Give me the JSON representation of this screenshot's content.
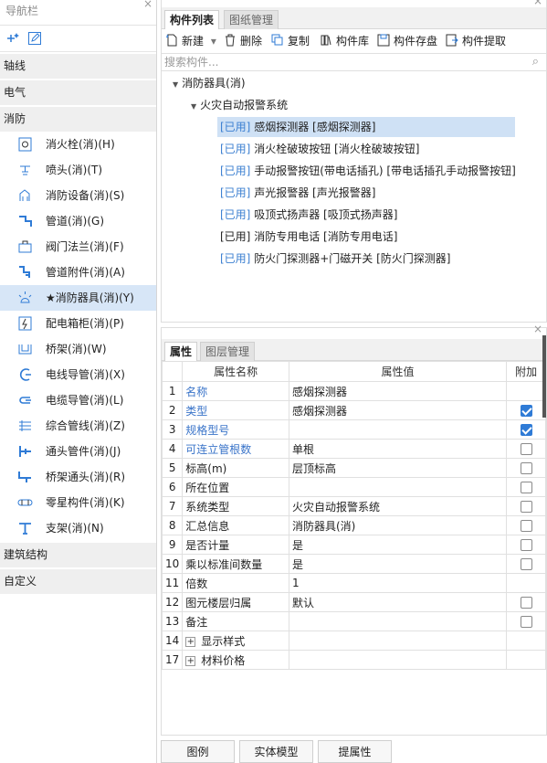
{
  "nav": {
    "title": "导航栏",
    "close": "×",
    "categories": {
      "axis": "轴线",
      "electric": "电气",
      "fire": "消防",
      "building": "建筑结构",
      "custom": "自定义"
    },
    "items": [
      {
        "label": "消火栓(消)(H)"
      },
      {
        "label": "喷头(消)(T)"
      },
      {
        "label": "消防设备(消)(S)"
      },
      {
        "label": "管道(消)(G)"
      },
      {
        "label": "阀门法兰(消)(F)"
      },
      {
        "label": "管道附件(消)(A)"
      },
      {
        "label": "★消防器具(消)(Y)"
      },
      {
        "label": "配电箱柜(消)(P)"
      },
      {
        "label": "桥架(消)(W)"
      },
      {
        "label": "电线导管(消)(X)"
      },
      {
        "label": "电缆导管(消)(L)"
      },
      {
        "label": "综合管线(消)(Z)"
      },
      {
        "label": "通头管件(消)(J)"
      },
      {
        "label": "桥架通头(消)(R)"
      },
      {
        "label": "零星构件(消)(K)"
      },
      {
        "label": "支架(消)(N)"
      }
    ],
    "selected_index": 6
  },
  "top": {
    "close": "×",
    "tabs": [
      "构件列表",
      "图纸管理"
    ],
    "toolbar": {
      "new": "新建",
      "new_dropdown": "▾",
      "delete": "删除",
      "copy": "复制",
      "library": "构件库",
      "save": "构件存盘",
      "extract": "构件提取"
    },
    "search_placeholder": "搜索构件...",
    "search_icon": "⌕",
    "tree_root": "消防器具(消)",
    "tree_group": "火灾自动报警系统",
    "components": [
      {
        "tag": "[已用]",
        "name": "感烟探测器 [感烟探测器]"
      },
      {
        "tag": "[已用]",
        "name": "消火栓破玻按钮 [消火栓破玻按钮]"
      },
      {
        "tag": "[已用]",
        "name": "手动报警按钮(带电话插孔) [带电话插孔手动报警按钮]"
      },
      {
        "tag": "[已用]",
        "name": "声光报警器 [声光报警器]"
      },
      {
        "tag": "[已用]",
        "name": "吸顶式扬声器 [吸顶式扬声器]"
      },
      {
        "tag": "[已用]",
        "name": "消防专用电话 [消防专用电话]"
      },
      {
        "tag": "[已用]",
        "name": "防火门探测器+门磁开关 [防火门探测器]"
      }
    ]
  },
  "props": {
    "close": "×",
    "tabs": [
      "属性",
      "图层管理"
    ],
    "headers": {
      "name": "属性名称",
      "value": "属性值",
      "extra": "附加"
    },
    "rows": [
      {
        "num": "1",
        "name": "名称",
        "value": "感烟探测器",
        "blue": true,
        "cb": "none"
      },
      {
        "num": "2",
        "name": "类型",
        "value": "感烟探测器",
        "blue": true,
        "cb": "on"
      },
      {
        "num": "3",
        "name": "规格型号",
        "value": "",
        "blue": true,
        "cb": "on"
      },
      {
        "num": "4",
        "name": "可连立管根数",
        "value": "单根",
        "blue": true,
        "cb": "off"
      },
      {
        "num": "5",
        "name": "标高(m)",
        "value": "层顶标高",
        "blue": false,
        "cb": "off"
      },
      {
        "num": "6",
        "name": "所在位置",
        "value": "",
        "blue": false,
        "cb": "off"
      },
      {
        "num": "7",
        "name": "系统类型",
        "value": "火灾自动报警系统",
        "blue": false,
        "cb": "off"
      },
      {
        "num": "8",
        "name": "汇总信息",
        "value": "消防器具(消)",
        "blue": false,
        "cb": "off"
      },
      {
        "num": "9",
        "name": "是否计量",
        "value": "是",
        "blue": false,
        "cb": "off"
      },
      {
        "num": "10",
        "name": "乘以标准间数量",
        "value": "是",
        "blue": false,
        "cb": "off"
      },
      {
        "num": "11",
        "name": "倍数",
        "value": "1",
        "blue": false,
        "cb": "none"
      },
      {
        "num": "12",
        "name": "图元楼层归属",
        "value": "默认",
        "blue": false,
        "cb": "off"
      },
      {
        "num": "13",
        "name": "备注",
        "value": "",
        "blue": false,
        "cb": "off"
      },
      {
        "num": "14",
        "name": "显示样式",
        "value": "",
        "blue": false,
        "cb": "none",
        "expand": "+"
      },
      {
        "num": "17",
        "name": "材料价格",
        "value": "",
        "blue": false,
        "cb": "none",
        "expand": "+"
      }
    ]
  },
  "bottom_buttons": [
    "图例",
    "实体模型",
    "提属性"
  ],
  "colors": {
    "accent": "#2f7bd6",
    "selected": "#d7e6f7",
    "link": "#3a74c9"
  }
}
